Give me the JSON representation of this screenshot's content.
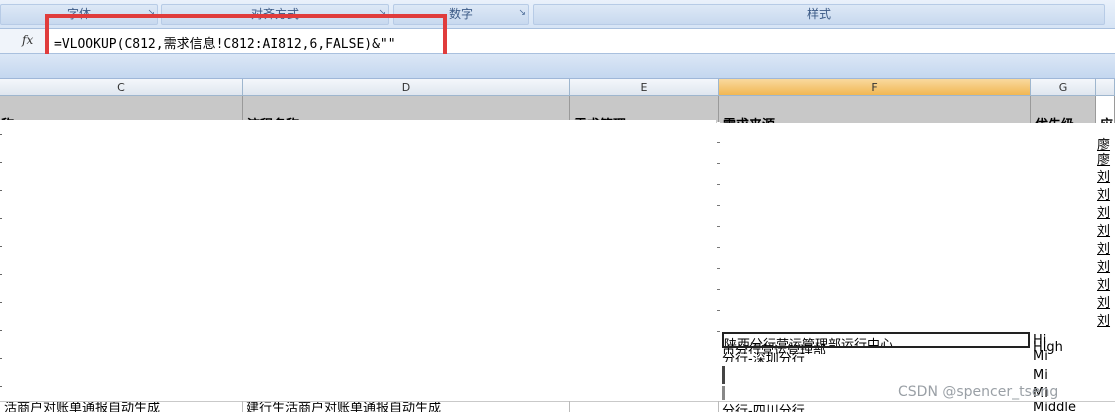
{
  "ribbon": {
    "groups": [
      "字体",
      "对齐方式",
      "数字",
      "样式"
    ]
  },
  "formula_bar": {
    "fx_label": "fx",
    "formula": "=VLOOKUP(C812,需求信息!C812:AI812,6,FALSE)&\"\""
  },
  "columns": [
    "C",
    "D",
    "E",
    "F",
    "G"
  ],
  "header_row": {
    "c": "名称",
    "d": "流程名称",
    "e": "需求管理",
    "f": "需求来源",
    "g": "优先级",
    "h": "应"
  },
  "col_h_values": [
    "廖",
    "廖",
    "刘",
    "刘",
    "刘",
    "刘",
    "刘",
    "刘",
    "刘",
    "刘",
    "刘"
  ],
  "col_f_values": [
    "市分行营运管理部",
    "陕西分行营运管理部运行中心",
    "分行-深圳分行",
    "",
    "",
    "分行-四川分行"
  ],
  "col_g_values": [
    "High",
    "Hi",
    "Mi",
    "Mi",
    "Mi",
    "Middle"
  ],
  "last_row": {
    "c": "活商户对账单通报自动生成",
    "d": "建行生活商户对账单通报自动生成"
  },
  "watermark": "CSDN @spencer_tseng"
}
